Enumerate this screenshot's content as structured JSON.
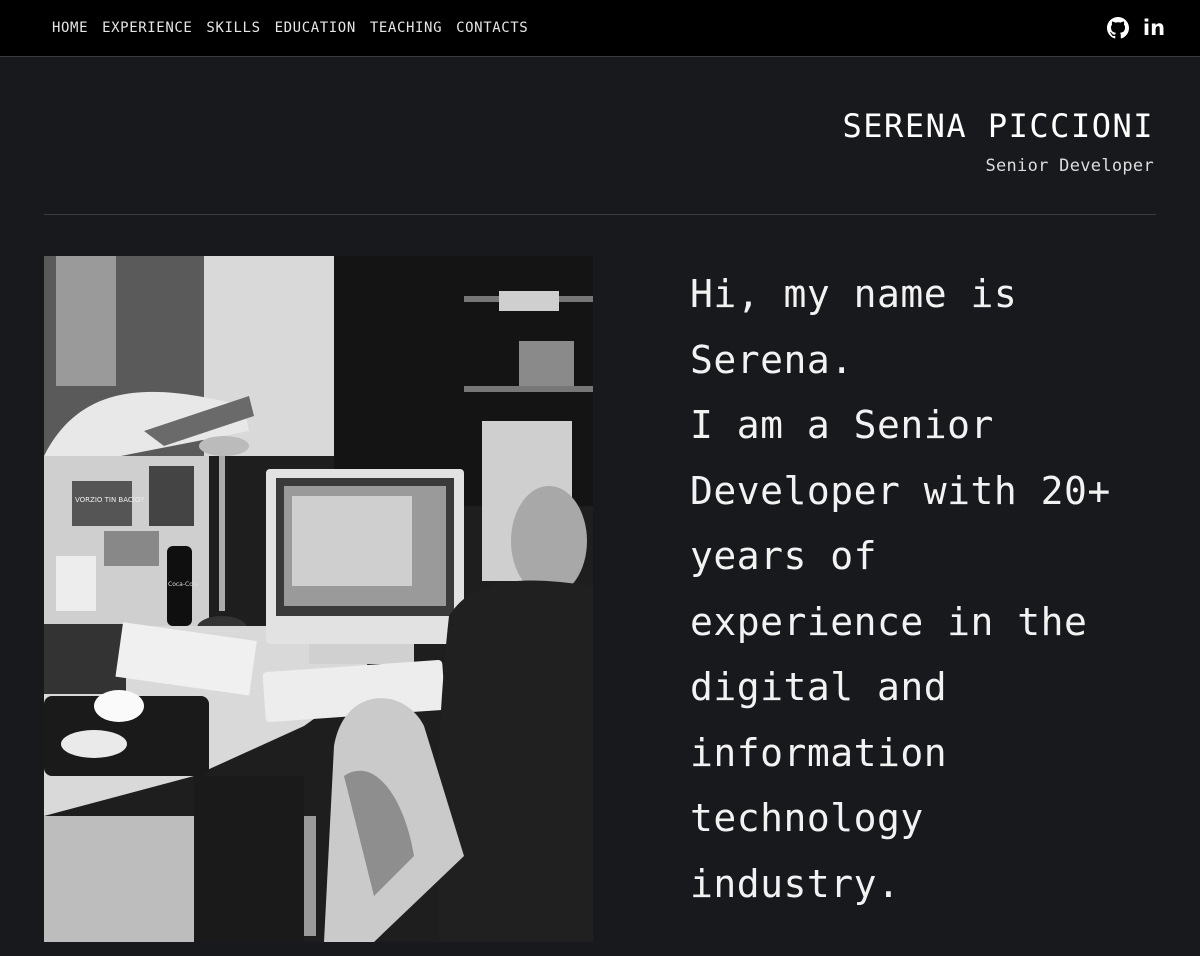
{
  "nav": {
    "items": [
      "HOME",
      "EXPERIENCE",
      "SKILLS",
      "EDUCATION",
      "TEACHING",
      "CONTACTS"
    ]
  },
  "social": {
    "icons": [
      "github-icon",
      "linkedin-icon"
    ],
    "linkedin_label": "in"
  },
  "header": {
    "name": "SERENA PICCIONI",
    "role": "Senior Developer"
  },
  "intro": {
    "lines": [
      "Hi, my name is",
      "Serena.",
      "I am a Senior",
      "Developer with 20+",
      "years of",
      "experience in the",
      "digital and",
      "information",
      "technology",
      "industry."
    ]
  },
  "photo": {
    "poster_text": "VORZIO TIN BACIO?",
    "bottle_text": "Coca-Cola"
  },
  "colors": {
    "background": "#18191d",
    "topbar": "#000000",
    "text": "#e9e9ea",
    "divider": "#3c3d42"
  }
}
